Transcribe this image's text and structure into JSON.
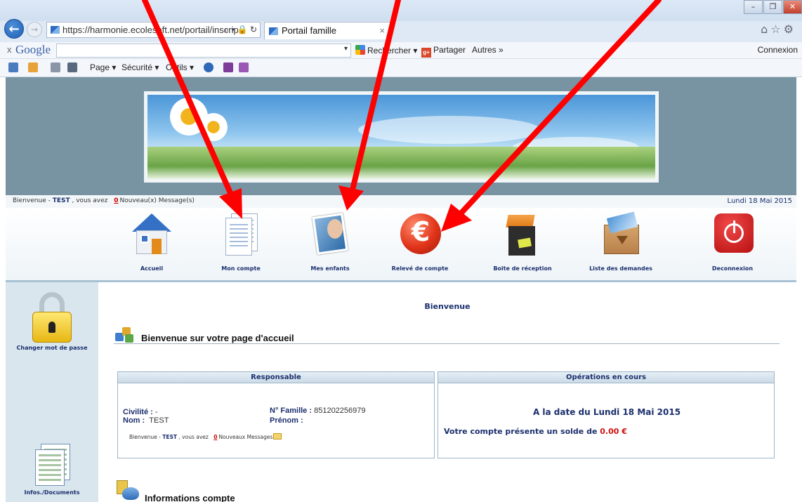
{
  "browser": {
    "url": "https://harmonie.ecolesoft.net/portail/inscrip",
    "tab_title": "Portail famille",
    "tab_close": "×",
    "address_tools": "⌕ ▾ 🔒 ↻",
    "google_x": "x",
    "google_logo": "Google",
    "search_label": "Rechercher ▾",
    "share_label": "Partager",
    "more_label": "Autres »",
    "connexion_label": "Connexion",
    "command_bar": {
      "page_label": "Page ▾",
      "security_label": "Sécurité ▾",
      "tools_label": "Outils ▾"
    }
  },
  "header": {
    "welcome_prefix": "Bienvenue - ",
    "user": "TEST",
    "welcome_mid": " , vous avez ",
    "message_count": "0",
    "messages_label": "Nouveau(x) Message(s)",
    "date": "Lundi 18 Mai 2015"
  },
  "nav": {
    "items": [
      {
        "label": "Accueil",
        "icon": "house-icon"
      },
      {
        "label": "Mon compte",
        "icon": "documents-icon"
      },
      {
        "label": "Mes enfants",
        "icon": "child-photo-icon"
      },
      {
        "label": "Relevé de compte",
        "icon": "euro-icon"
      },
      {
        "label": "Boite de réception",
        "icon": "inbox-icon"
      },
      {
        "label": "Liste des demandes",
        "icon": "request-box-icon"
      },
      {
        "label": "Deconnexion",
        "icon": "power-icon"
      }
    ]
  },
  "sidebar": {
    "items": [
      {
        "label": "Changer mot de passe",
        "icon": "padlock-icon"
      },
      {
        "label": "Infos./Documents",
        "icon": "document-icon"
      }
    ]
  },
  "main": {
    "title": "Bienvenue",
    "section_title": "Bienvenue sur votre page d'accueil",
    "responsable": {
      "header": "Responsable",
      "civilite_label": "Civilité :",
      "civilite_value": "-",
      "nom_label": "Nom :",
      "nom_value": "TEST",
      "famille_label": "N° Famille :",
      "famille_value": "851202256979",
      "prenom_label": "Prénom :",
      "prenom_value": "",
      "welcome_prefix": "Bienvenue - ",
      "user": "TEST",
      "welcome_mid": " , vous avez ",
      "message_count": "0",
      "messages_label": "Nouveaux Messages"
    },
    "operations": {
      "header": "Opérations en cours",
      "date_text": "A la date du  Lundi 18 Mai 2015",
      "balance_text": "Votre compte présente un solde de ",
      "balance_amount": "0.00 €"
    },
    "info_title": "Informations compte"
  },
  "colors": {
    "navy": "#1b2f6d",
    "alert_red": "#d01010",
    "annotation_arrow": "#ff0000",
    "header_bg": "#7894a3",
    "sidebar_bg": "#d9e6ee"
  }
}
